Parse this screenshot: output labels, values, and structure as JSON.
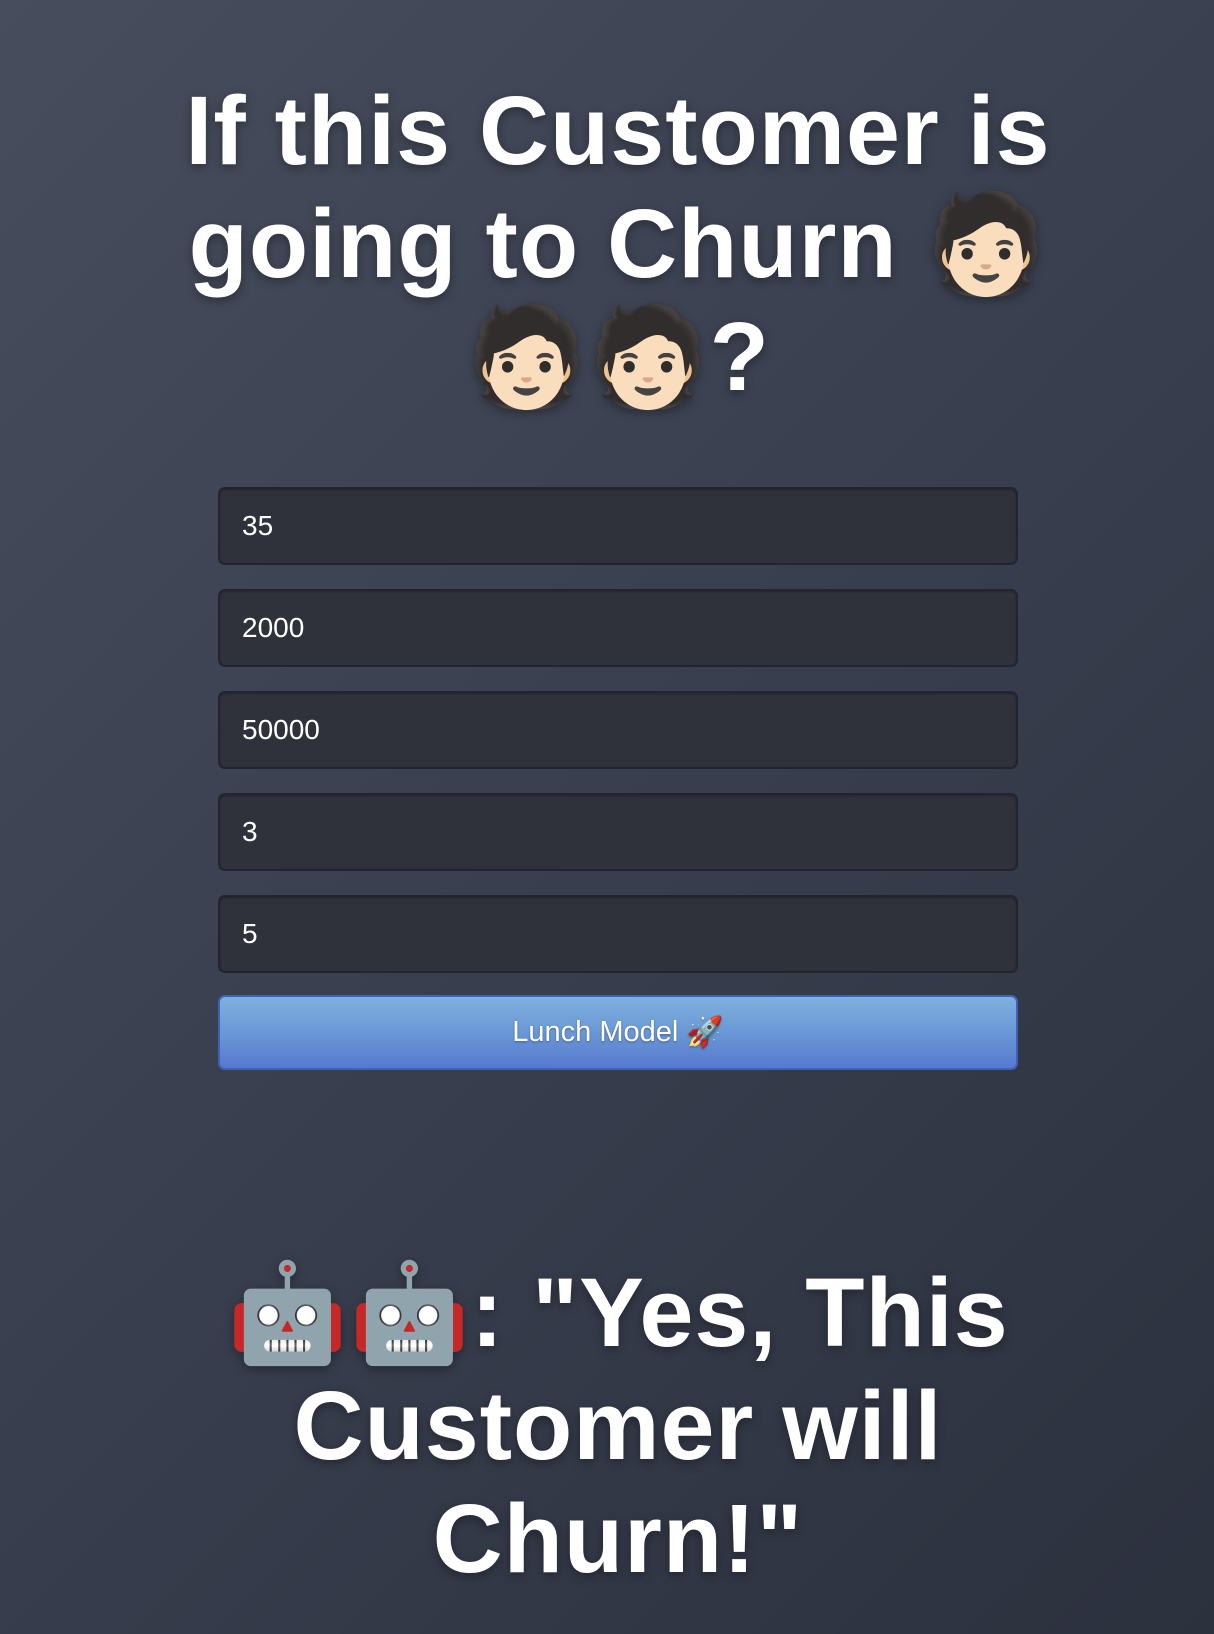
{
  "heading": {
    "text": "If this Customer is going to Churn 🧑🏻🧑🏻🧑🏻?"
  },
  "form": {
    "fields": [
      {
        "value": "35"
      },
      {
        "value": "2000"
      },
      {
        "value": "50000"
      },
      {
        "value": "3"
      },
      {
        "value": "5"
      }
    ],
    "submit_label": "Lunch Model",
    "submit_icon": "🚀"
  },
  "result": {
    "text": "🤖🤖: \"Yes, This Customer will Churn!\""
  },
  "colors": {
    "background": "#3a4050",
    "field_background": "#2f323b",
    "button_top": "#7fb0de",
    "button_bottom": "#5679cf",
    "text": "#ffffff"
  }
}
